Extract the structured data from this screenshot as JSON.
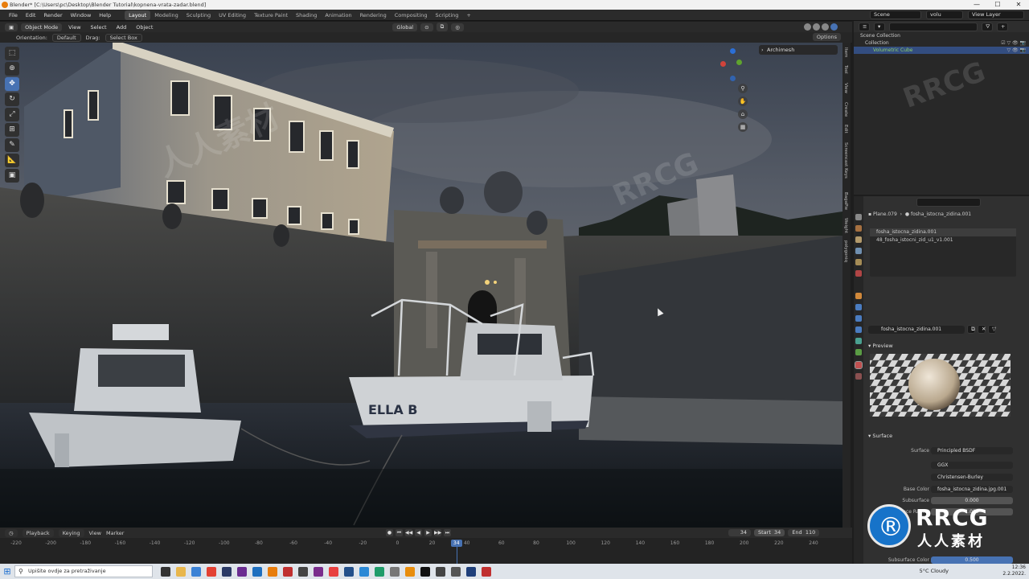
{
  "window": {
    "title": "Blender* [C:\\Users\\pc\\Desktop\\Blender Tutorial\\kopnena-vrata-zadar.blend]",
    "controls": [
      "—",
      "☐",
      "✕"
    ]
  },
  "watermark": {
    "brand": "RRCG",
    "site_cn": "人人素材"
  },
  "menubar": {
    "items": [
      "File",
      "Edit",
      "Render",
      "Window",
      "Help"
    ],
    "workspaces": [
      "Layout",
      "Modeling",
      "Sculpting",
      "UV Editing",
      "Texture Paint",
      "Shading",
      "Animation",
      "Rendering",
      "Compositing",
      "Scripting",
      "+"
    ],
    "active_workspace": "Layout",
    "scene": "Scene",
    "search_value": "volu",
    "view_layer": "View Layer"
  },
  "viewport_header": {
    "mode": "Object Mode",
    "menus": [
      "View",
      "Select",
      "Add",
      "Object"
    ],
    "transform_orientation": "Global"
  },
  "viewport_sub": {
    "orientation_label": "Orientation:",
    "orientation_value": "Default",
    "drag_label": "Drag:",
    "drag_value": "Select Box",
    "options": "Options"
  },
  "toolbar_icons": [
    "select-box-icon",
    "cursor-icon",
    "move-icon",
    "rotate-icon",
    "scale-icon",
    "transform-icon",
    "annotate-icon",
    "measure-icon",
    "add-cube-icon"
  ],
  "archimesh_panel": "Archimesh",
  "npanel_tabs": [
    "Item",
    "Tool",
    "View",
    "Create",
    "Edit",
    "Screencast Keys",
    "BagaPie",
    "Weight",
    "polygoniq"
  ],
  "scene": {
    "boat_name": "ELLA B",
    "colors": {
      "sky": "#3a4250",
      "building": "#8d8a84",
      "water": "#141a20",
      "boat": "#c6c9cc"
    }
  },
  "timeline": {
    "menus": [
      "Playback",
      "Keying",
      "View",
      "Marker"
    ],
    "current_frame": "34",
    "start_label": "Start",
    "start_value": "34",
    "end_label": "End",
    "end_value": "110",
    "ruler": [
      "-220",
      "-200",
      "-180",
      "-160",
      "-140",
      "-120",
      "-100",
      "-80",
      "-60",
      "-40",
      "-20",
      "0",
      "20",
      "40",
      "60",
      "80",
      "100",
      "120",
      "140",
      "160",
      "180",
      "200",
      "220",
      "240"
    ],
    "playhead": "34"
  },
  "outliner": {
    "search_placeholder": "",
    "rows": [
      {
        "label": "Scene Collection",
        "selected": false
      },
      {
        "label": "Collection",
        "selected": false
      },
      {
        "label": "Volumetric Cube",
        "selected": true
      }
    ]
  },
  "properties": {
    "object": "Plane.079",
    "material_path": "fosha_istocna_zidina.001",
    "slots": [
      "fosha_istocna_zidina.001",
      "48_fosha_istocni_zid_u1_v1.001"
    ],
    "material_name": "fosha_istocna_zidina.001",
    "preview_label": "Preview",
    "surface_label": "Surface",
    "fields": [
      {
        "key": "Surface",
        "value": "Principled BSDF",
        "style": "dark"
      },
      {
        "key": "",
        "value": "GGX",
        "style": "dark"
      },
      {
        "key": "",
        "value": "Christensen-Burley",
        "style": "dark"
      },
      {
        "key": "Base Color",
        "value": "fosha_istocna_zidina.jpg.001",
        "style": "dark"
      },
      {
        "key": "Subsurface",
        "value": "0.000",
        "style": "num"
      },
      {
        "key": "Subsurface Radius",
        "value": "1.000",
        "style": "num"
      }
    ],
    "bottom_value": "0.500",
    "bottom_label": "Subsurface Color"
  },
  "taskbar": {
    "search_placeholder": "Upišite ovdje za pretraživanje",
    "weather": "5°C  Cloudy",
    "time": "12:36",
    "date": "2.2.2022.",
    "udemy": "Udemy"
  }
}
